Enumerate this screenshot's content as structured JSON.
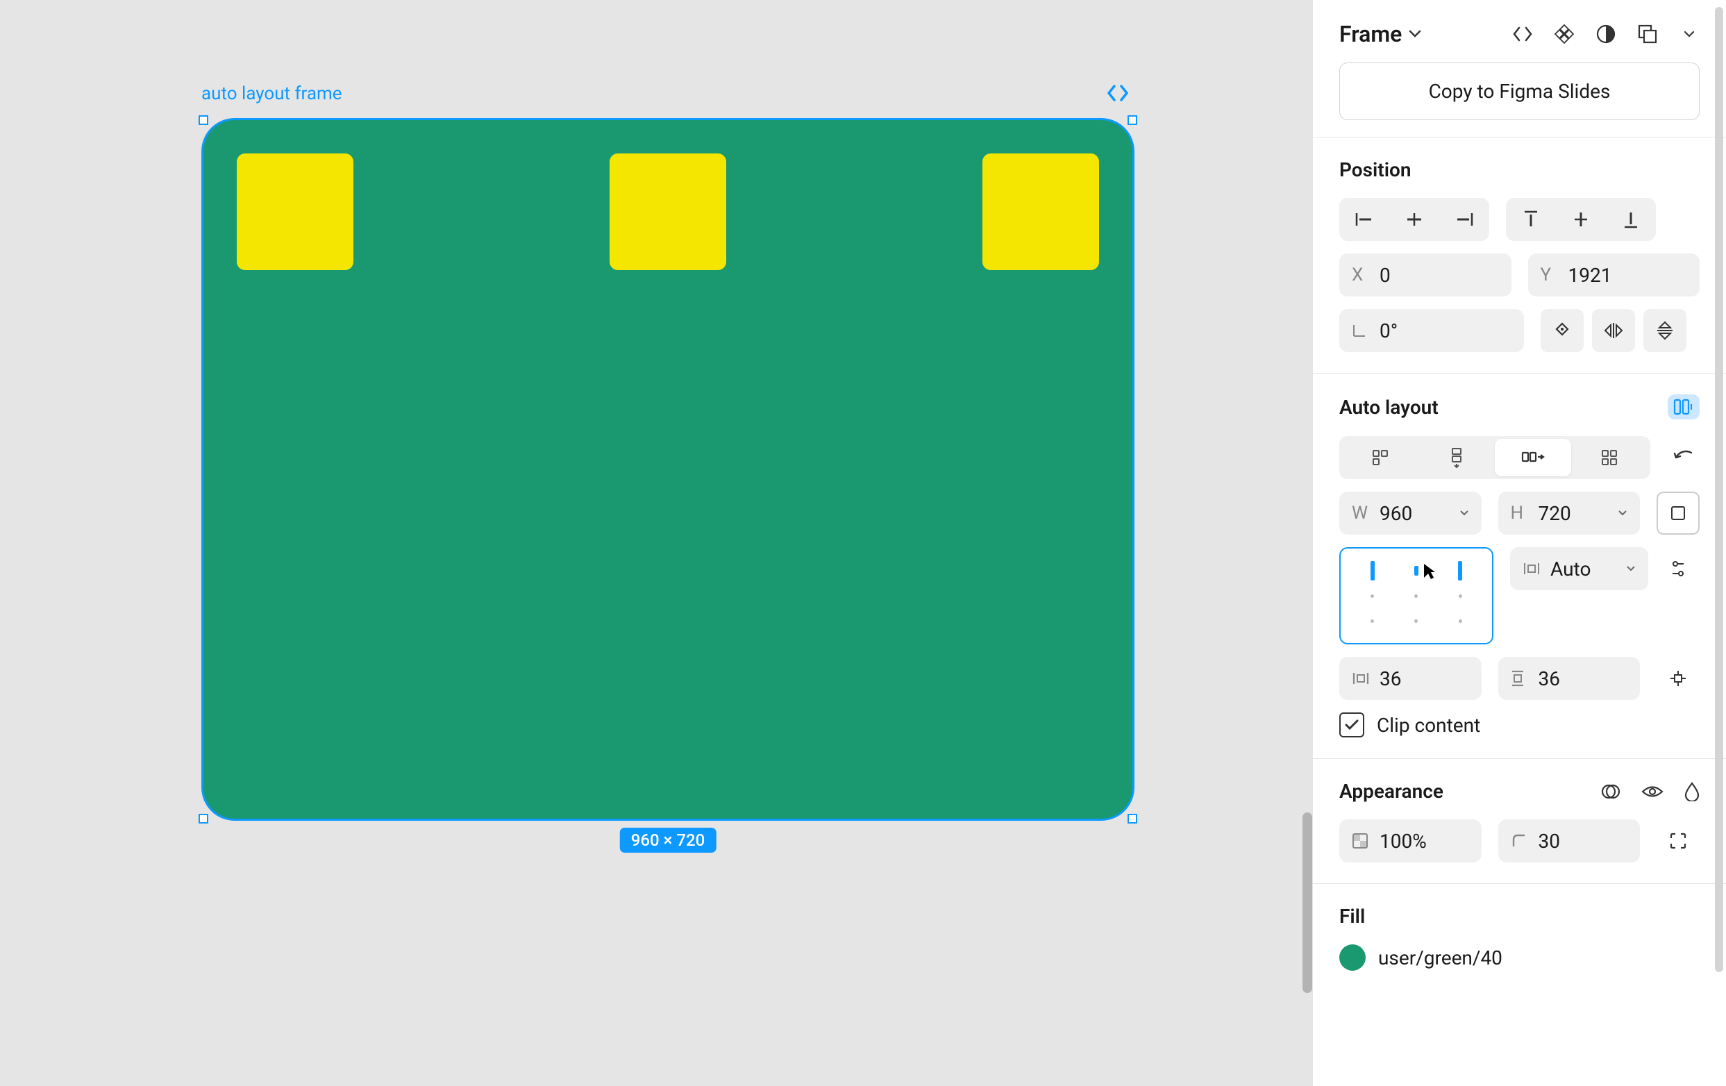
{
  "header": {
    "title": "Frame",
    "copy_button": "Copy to Figma Slides"
  },
  "canvas": {
    "frame_label": "auto layout frame",
    "dimensions_badge": "960 × 720"
  },
  "position": {
    "title": "Position",
    "x_label": "X",
    "x_value": "0",
    "y_label": "Y",
    "y_value": "1921",
    "rotation_value": "0°"
  },
  "auto_layout": {
    "title": "Auto layout",
    "w_label": "W",
    "w_value": "960",
    "h_label": "H",
    "h_value": "720",
    "gap_mode": "Auto",
    "pad_h": "36",
    "pad_v": "36",
    "clip_label": "Clip content"
  },
  "appearance": {
    "title": "Appearance",
    "opacity": "100%",
    "corner_radius": "30"
  },
  "fill": {
    "title": "Fill",
    "color_name": "user/green/40"
  }
}
